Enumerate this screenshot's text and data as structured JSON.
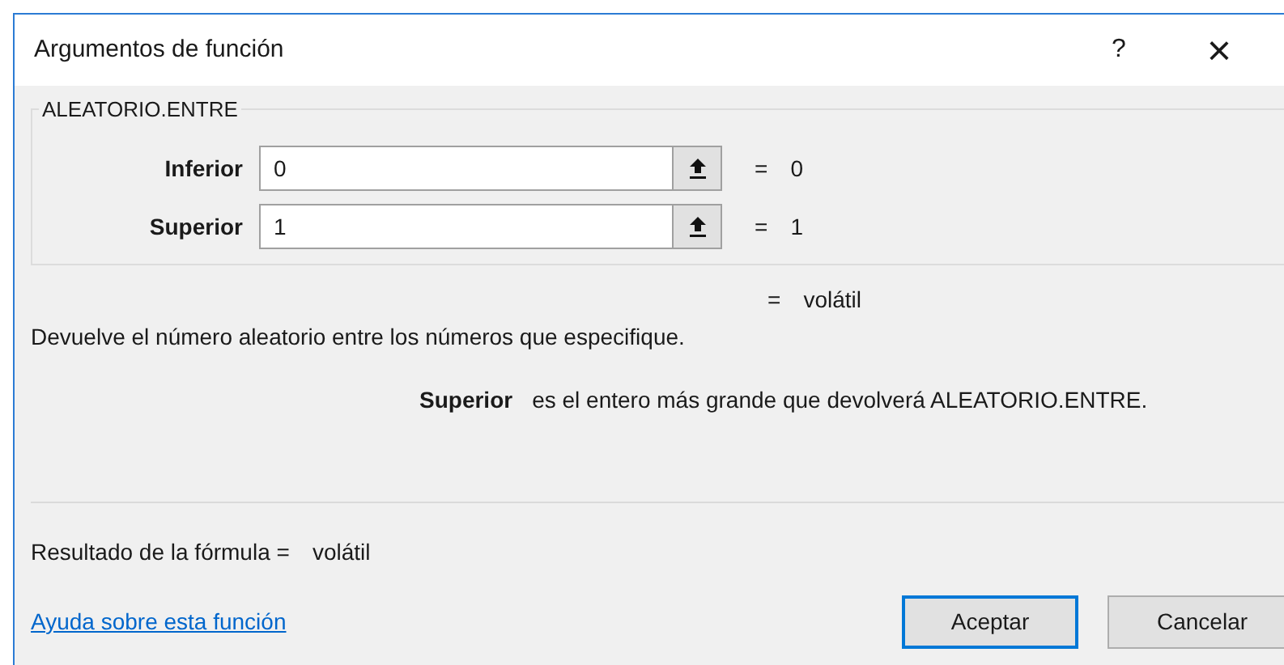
{
  "window": {
    "title": "Argumentos de función",
    "help_button": "?",
    "close_button": "×"
  },
  "function_group": {
    "title": "ALEATORIO.ENTRE",
    "arguments": [
      {
        "label": "Inferior",
        "value": "0",
        "equals": "=",
        "result": "0"
      },
      {
        "label": "Superior",
        "value": "1",
        "equals": "=",
        "result": "1"
      }
    ]
  },
  "function_result": {
    "equals": "=",
    "value": "volátil"
  },
  "description": "Devuelve el número aleatorio entre los números que especifique.",
  "argument_help": {
    "name": "Superior",
    "text": "es el entero más grande que devolverá ALEATORIO.ENTRE."
  },
  "formula_result": {
    "label": "Resultado de la fórmula =",
    "value": "volátil"
  },
  "help_link": "Ayuda sobre esta función",
  "buttons": [
    {
      "label": "Aceptar",
      "default": true
    },
    {
      "label": "Cancelar",
      "default": false
    }
  ]
}
